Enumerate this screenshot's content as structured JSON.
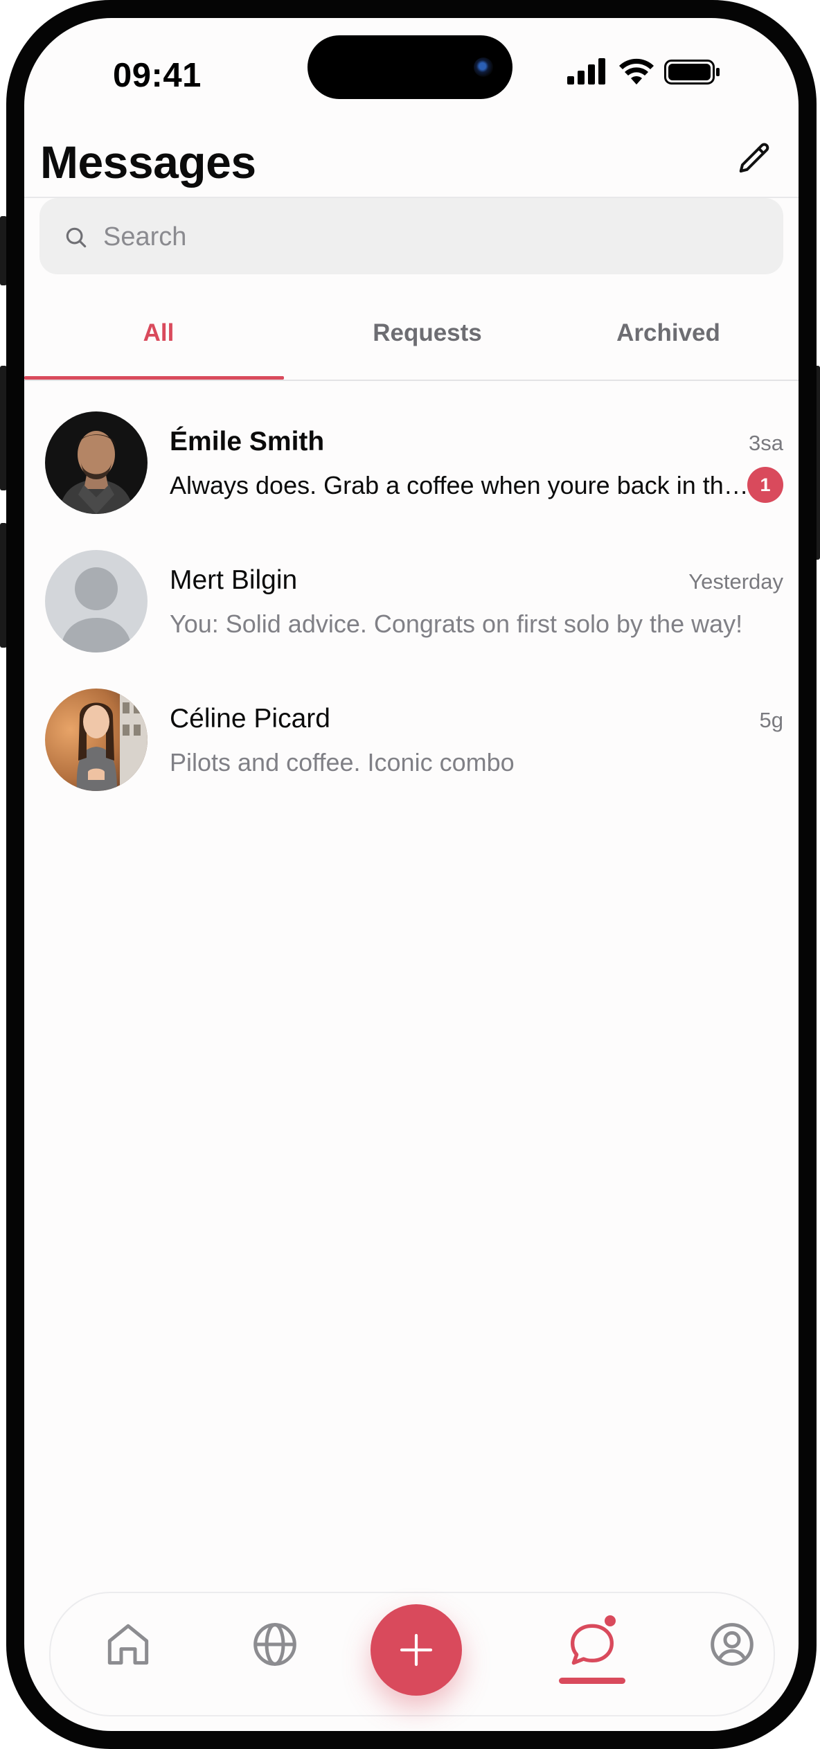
{
  "status_bar": {
    "time": "09:41"
  },
  "header": {
    "title": "Messages",
    "compose_icon": "pencil-icon"
  },
  "search": {
    "placeholder": "Search",
    "value": "",
    "icon": "search-icon"
  },
  "tabs": [
    {
      "label": "All",
      "active": true
    },
    {
      "label": "Requests",
      "active": false
    },
    {
      "label": "Archived",
      "active": false
    }
  ],
  "conversations": [
    {
      "name": "Émile Smith",
      "time": "3sa",
      "preview": "Always does. Grab a coffee when youre back in the city",
      "unread_count": "1",
      "unread": true
    },
    {
      "name": "Mert Bilgin",
      "time": "Yesterday",
      "preview": "You: Solid advice. Congrats on first solo by the way!",
      "unread": false
    },
    {
      "name": "Céline Picard",
      "time": "5g",
      "preview": "Pilots and coffee. Iconic combo",
      "unread": false
    }
  ],
  "bottom_nav": {
    "items": [
      "home-icon",
      "globe-icon",
      "plus-icon",
      "chat-bubble-icon",
      "profile-icon"
    ],
    "active": "chat-bubble-icon"
  },
  "colors": {
    "accent": "#d94a5c",
    "background": "#fdfcfc",
    "search_bg": "#efefef"
  }
}
